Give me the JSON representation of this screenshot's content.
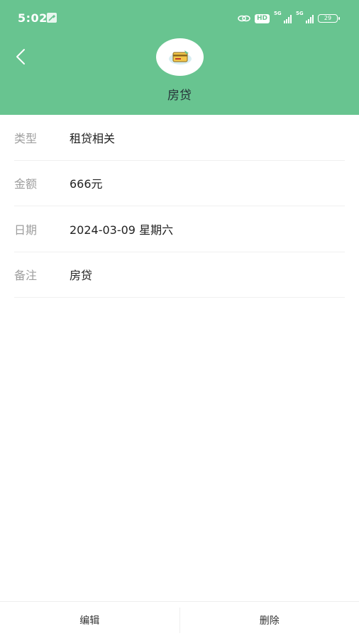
{
  "status_bar": {
    "time": "5:02",
    "hd": "HD",
    "net1": "5G",
    "net2": "5G",
    "battery": "29"
  },
  "header": {
    "title": "房贷",
    "icon": "credit-card-icon"
  },
  "details": [
    {
      "label": "类型",
      "value": "租贷相关"
    },
    {
      "label": "金额",
      "value": "666元"
    },
    {
      "label": "日期",
      "value": "2024-03-09 星期六"
    },
    {
      "label": "备注",
      "value": "房贷"
    }
  ],
  "actions": {
    "edit": "编辑",
    "delete": "删除"
  },
  "colors": {
    "header": "#68c490"
  }
}
